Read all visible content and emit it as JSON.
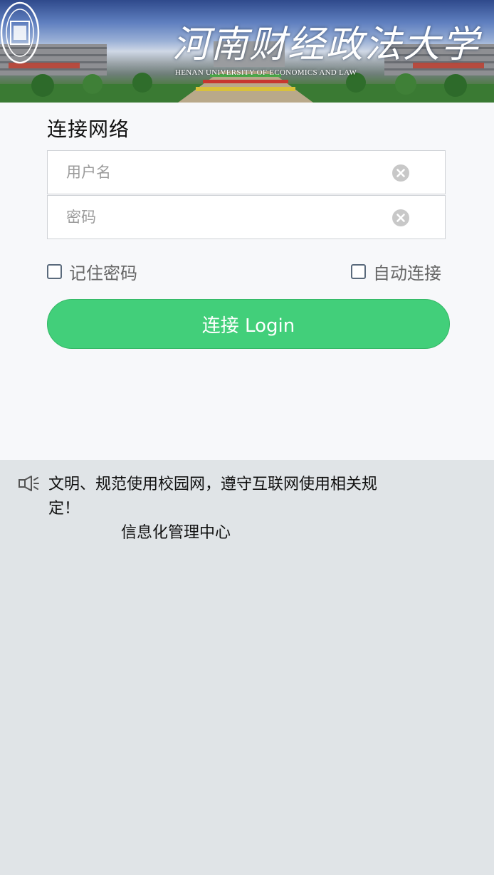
{
  "banner": {
    "title": "河南财经政法大学",
    "subtitle": "HENAN UNIVERSITY OF ECONOMICS AND LAW"
  },
  "login": {
    "title": "连接网络",
    "username_placeholder": "用户名",
    "password_placeholder": "密码",
    "username_value": "",
    "password_value": "",
    "remember_label": "记住密码",
    "auto_label": "自动连接",
    "button_label": "连接 Login"
  },
  "notice": {
    "text": "文明、规范使用校园网，遵守互联网使用相关规定！",
    "signature": "信息化管理中心"
  },
  "colors": {
    "primary_button": "#42cf7a",
    "panel_bg": "#f7f8fa",
    "notice_bg": "#e0e4e7"
  },
  "icons": {
    "clear": "clear-icon",
    "speaker": "speaker-icon",
    "seal": "university-seal-icon"
  }
}
